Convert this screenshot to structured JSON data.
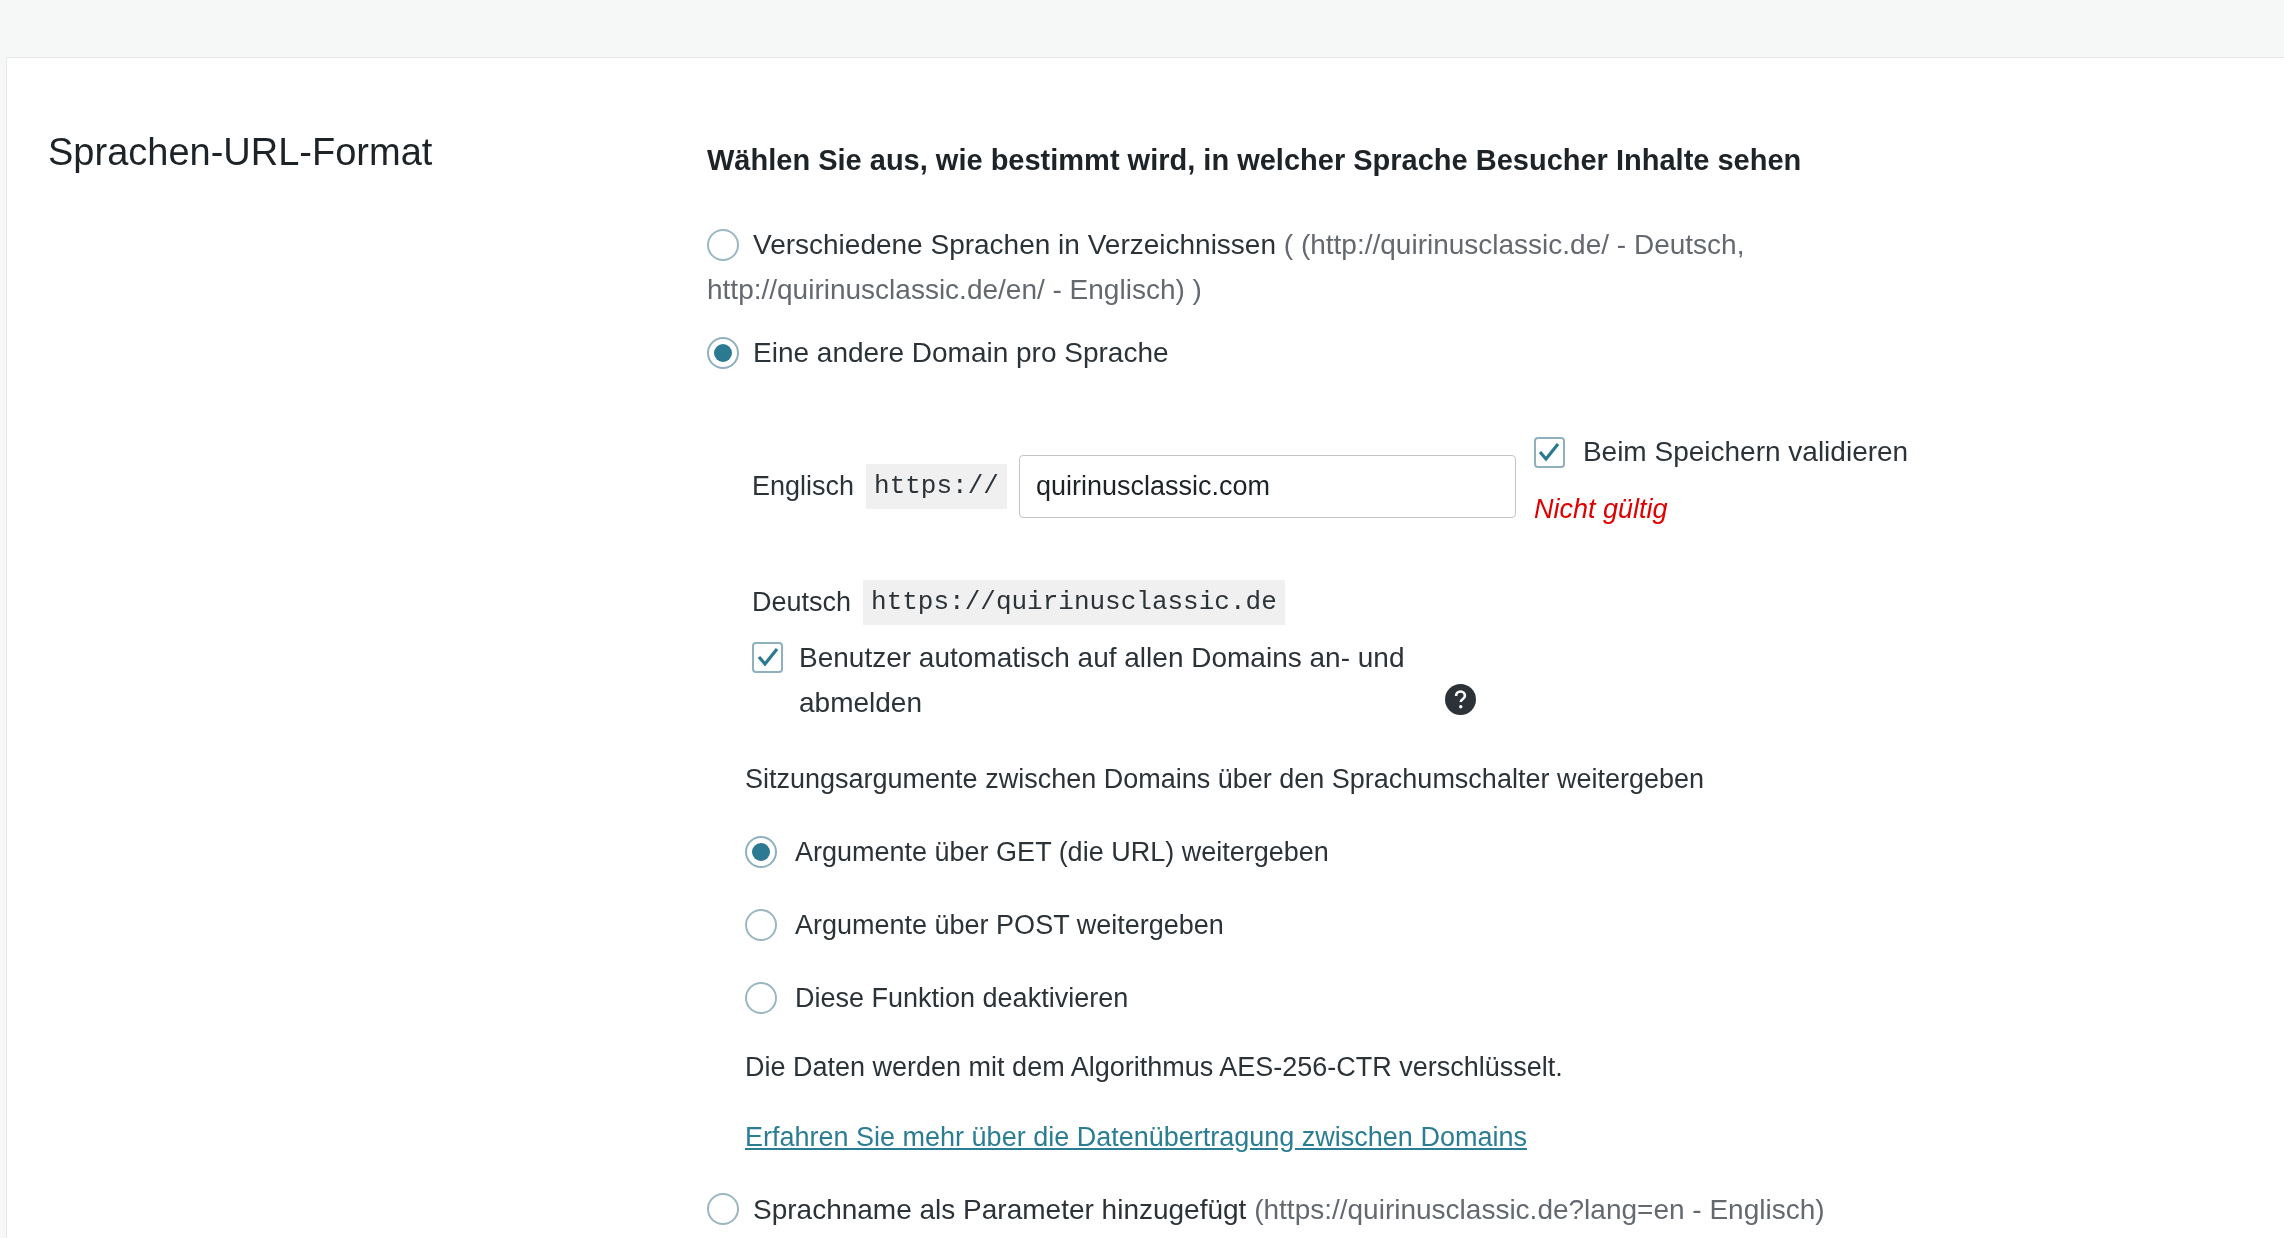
{
  "section_title": "Sprachen-URL-Format",
  "heading": "Wählen Sie aus, wie bestimmt wird, in welcher Sprache Besucher Inhalte sehen",
  "url_formats": [
    {
      "label": "Verschiedene Sprachen in Verzeichnissen",
      "hint": "( (http://quirinusclassic.de/ - Deutsch, http://quirinusclassic.de/en/ - Englisch) )",
      "selected": false
    },
    {
      "label": "Eine andere Domain pro Sprache",
      "selected": true
    },
    {
      "label": "Sprachname als Parameter hinzugefügt",
      "hint": "(https://quirinusclassic.de?lang=en - Englisch)",
      "selected": false
    }
  ],
  "domains": [
    {
      "language": "Englisch",
      "kind": "input",
      "prefix": "https://",
      "value": "quirinusclassic.com"
    },
    {
      "language": "Deutsch",
      "kind": "fixed",
      "prefix": "https://quirinusclassic.de"
    }
  ],
  "validate": {
    "label": "Beim Speichern validieren",
    "checked": true
  },
  "validation_error": "Nicht gültig",
  "auto_login": {
    "label": "Benutzer automatisch auf allen Domains an- und abmelden",
    "checked": true
  },
  "session": {
    "title": "Sitzungsargumente zwischen Domains über den Sprachumschalter weitergeben",
    "options": [
      {
        "label": "Argumente über GET (die URL) weitergeben",
        "selected": true
      },
      {
        "label": "Argumente über POST weitergeben",
        "selected": false
      },
      {
        "label": "Diese Funktion deaktivieren",
        "selected": false
      }
    ],
    "note": "Die Daten werden mit dem Algorithmus AES-256-CTR verschlüsselt.",
    "link": "Erfahren Sie mehr über die Datenübertragung zwischen Domains"
  }
}
